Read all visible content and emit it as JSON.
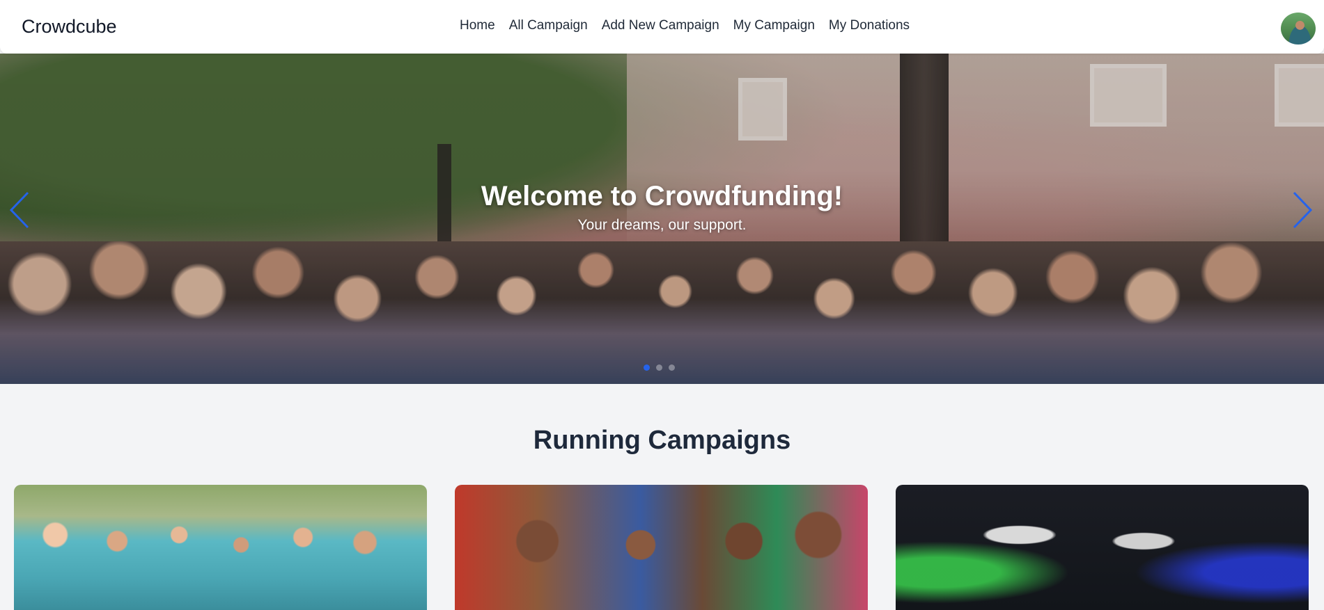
{
  "navbar": {
    "brand": "Crowdcube",
    "links": [
      "Home",
      "All Campaign",
      "Add New Campaign",
      "My Campaign",
      "My Donations"
    ]
  },
  "hero": {
    "title": "Welcome to Crowdfunding!",
    "subtitle": "Your dreams, our support.",
    "slide_count": 3,
    "active_slide": 1
  },
  "campaigns": {
    "section_title": "Running Campaigns"
  },
  "colors": {
    "accent": "#2563eb",
    "page_bg": "#f3f4f6",
    "heading": "#1e293b"
  },
  "icons": {
    "prev": "chevron-left-icon",
    "next": "chevron-right-icon"
  }
}
